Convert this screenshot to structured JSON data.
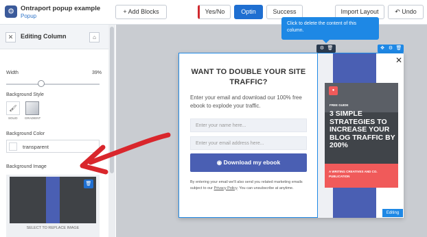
{
  "header": {
    "title": "Ontraport popup example",
    "subtitle": "Popup",
    "add_blocks": "+ Add Blocks",
    "tabs": [
      "Yes/No",
      "Optin",
      "Success"
    ],
    "import_layout": "Import Layout",
    "undo": "↶ Undo"
  },
  "panel": {
    "title": "Editing Column",
    "width_label": "Width",
    "width_value": "39%",
    "background_style_label": "Background Style",
    "style_solid": "SOLID",
    "style_gradient": "GRADIENT",
    "background_color_label": "Background Color",
    "background_color_value": "transparent",
    "background_image_label": "Background Image",
    "replace_image": "SELECT TO REPLACE IMAGE"
  },
  "tooltip": "Click to delete the content of this column.",
  "popup": {
    "heading": "WANT TO DOUBLE YOUR SITE TRAFFIC?",
    "description": "Enter your email and download our 100% free ebook to explode your traffic.",
    "name_placeholder": "Enter your name here...",
    "email_placeholder": "Enter your email address here...",
    "button": "Download my ebook",
    "fine_print_before": "By entering your email we'll also send you related marketing emails subject to our ",
    "fine_print_link": "Privacy Policy",
    "fine_print_after": ". You can unsubscribe at anytime."
  },
  "ebook": {
    "free_guide": "FREE GUIDE",
    "title": "3 SIMPLE STRATEGIES TO INCREASE YOUR BLOG TRAFFIC BY 200%",
    "publisher": "A WRITING CREATIVES AND CO. PUBLICATION"
  },
  "editing_tag": "Editing"
}
